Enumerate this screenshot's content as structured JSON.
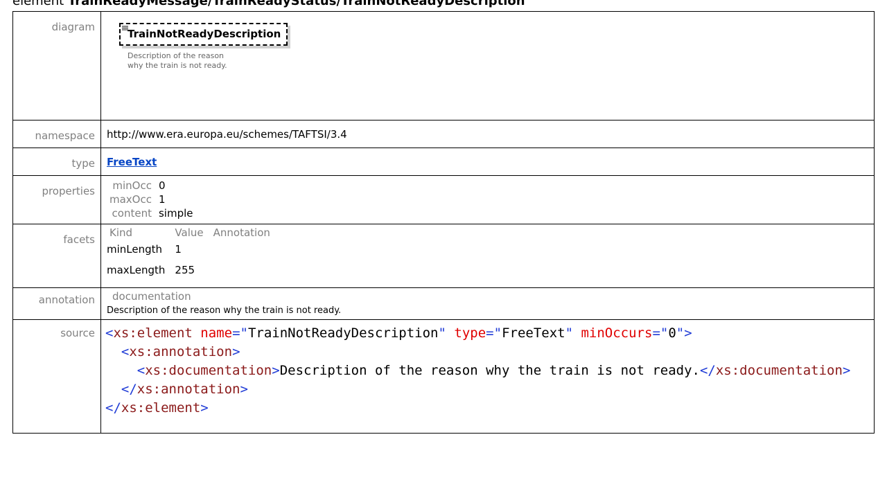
{
  "heading": {
    "prefix": "element ",
    "path": "TrainReadyMessage/TrainReadyStatus/TrainNotReadyDescription"
  },
  "rows": {
    "diagram_label": "diagram",
    "namespace_label": "namespace",
    "type_label": "type",
    "properties_label": "properties",
    "facets_label": "facets",
    "annotation_label": "annotation",
    "source_label": "source"
  },
  "diagram": {
    "element_name": "TrainNotReadyDescription",
    "doc_text": "Description of the reason why the train is not ready."
  },
  "namespace": "http://www.era.europa.eu/schemes/TAFTSI/3.4",
  "type": "FreeText",
  "properties": [
    {
      "key": "minOcc",
      "value": "0"
    },
    {
      "key": "maxOcc",
      "value": "1"
    },
    {
      "key": "content",
      "value": "simple"
    }
  ],
  "facets": {
    "headers": [
      "Kind",
      "Value",
      "Annotation"
    ],
    "rows": [
      {
        "kind": "minLength",
        "value": "1"
      },
      {
        "kind": "maxLength",
        "value": "255"
      }
    ]
  },
  "annotation": {
    "heading": "documentation",
    "text": "Description of the reason why the train is not ready."
  },
  "source": {
    "l1_open": "<",
    "l1_tag": "xs:element",
    "l1_attr1": "name",
    "l1_eq1": "=\"",
    "l1_val1": "TrainNotReadyDescription",
    "l1_q1": "\"",
    "l1_attr2": "type",
    "l1_eq2": "=\"",
    "l1_val2": "FreeText",
    "l1_q2": "\"",
    "l1_attr3": "minOccurs",
    "l1_eq3": "=\"",
    "l1_val3": "0",
    "l1_close": "\">",
    "l2_open": "<",
    "l2_tag": "xs:annotation",
    "l2_close": ">",
    "l3_open": "<",
    "l3_tag": "xs:documentation",
    "l3_close": ">",
    "l3_text": "Description of the reason why the train is not ready.",
    "l3_endopen": "</",
    "l3_endtag": "xs:documentation",
    "l3_endclose": ">",
    "l4_open": "</",
    "l4_tag": "xs:annotation",
    "l4_close": ">",
    "l5_open": "</",
    "l5_tag": "xs:element",
    "l5_close": ">"
  }
}
